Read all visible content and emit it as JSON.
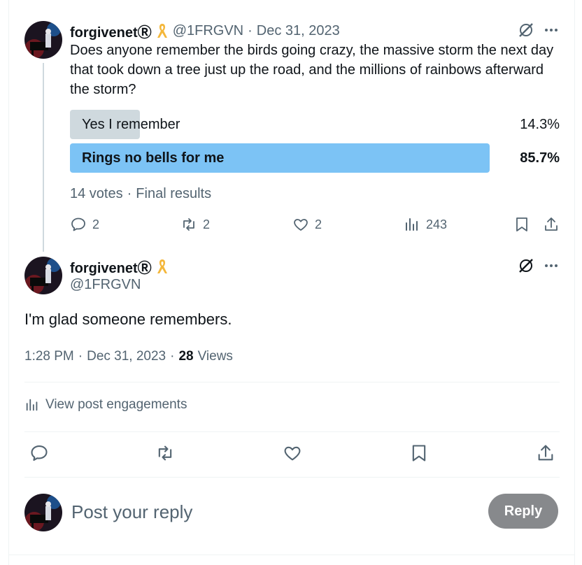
{
  "poll_tweet": {
    "author_name": "forgivenetⓇ",
    "handle": "@1FRGVN",
    "date": "Dec 31, 2023",
    "separator": "·",
    "text": "Does anyone remember the birds going crazy, the massive storm the next day that took down a tree just up the road, and the millions of rainbows afterward the storm?",
    "poll": {
      "options": [
        {
          "label": "Yes I remember",
          "percent_text": "14.3%",
          "percent": 14.3,
          "winner": false
        },
        {
          "label": "Rings no bells for me",
          "percent_text": "85.7%",
          "percent": 85.7,
          "winner": true
        }
      ],
      "votes": "14 votes",
      "status": "Final results"
    },
    "actions": {
      "replies": "2",
      "reposts": "2",
      "likes": "2",
      "views": "243"
    }
  },
  "main_tweet": {
    "author_name": "forgivenetⓇ",
    "handle": "@1FRGVN",
    "text": "I'm glad someone remembers.",
    "time": "1:28 PM",
    "date": "Dec 31, 2023",
    "views_count": "28",
    "views_label": "Views",
    "engagements_link": "View post engagements"
  },
  "reply_box": {
    "placeholder": "Post your reply",
    "button_label": "Reply"
  },
  "colors": {
    "accent_bar": "#7cc3f5",
    "loser_bar": "#cfd9de",
    "muted_text": "#536471",
    "reply_button": "#87898c",
    "ribbon": "#f4b73b"
  }
}
